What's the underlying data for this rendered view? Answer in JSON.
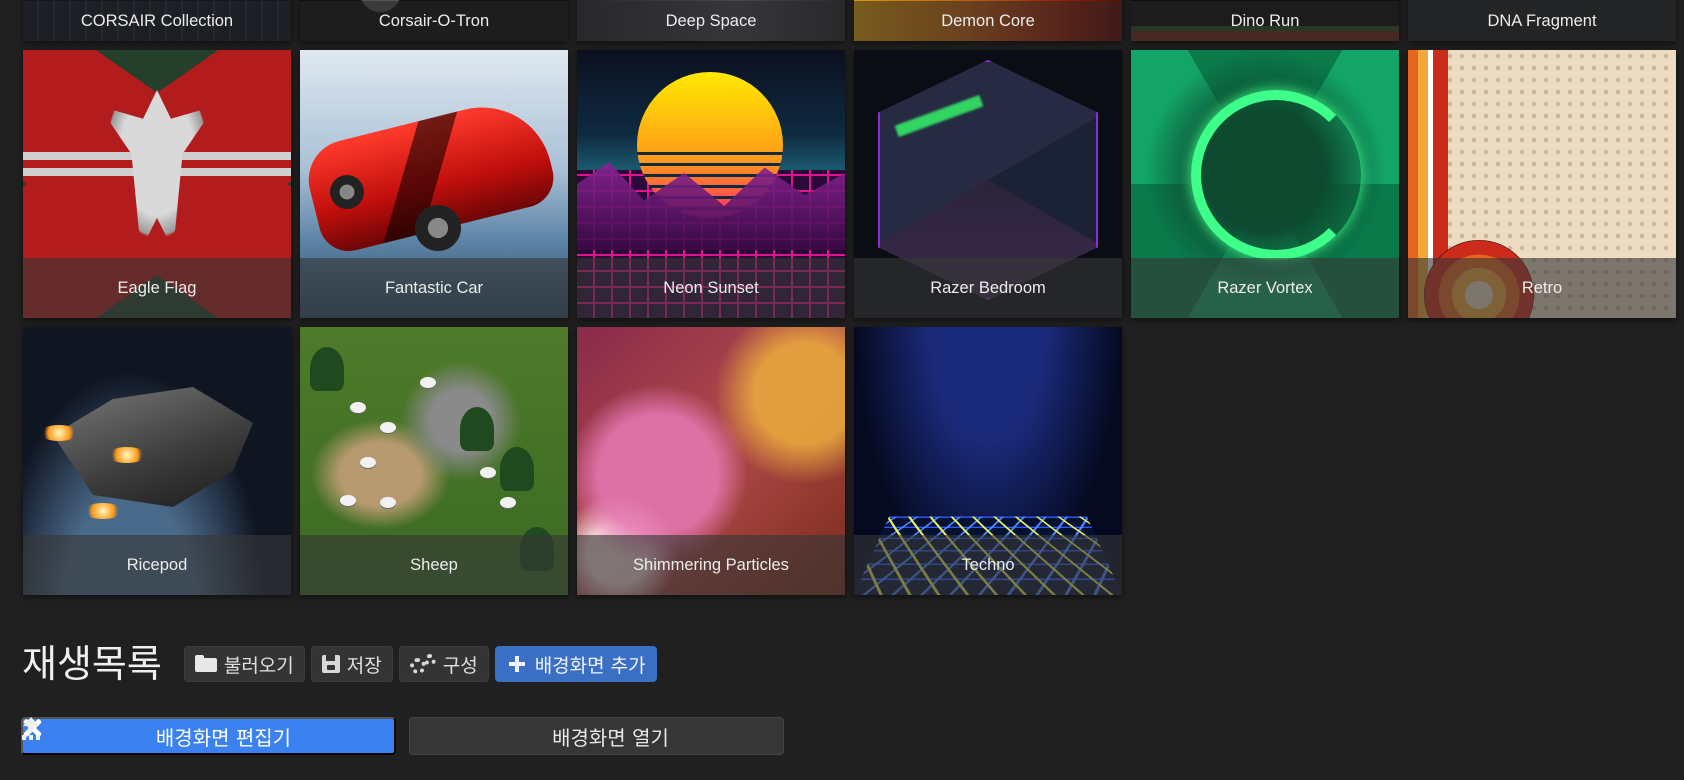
{
  "wallpapers": {
    "row_top": [
      {
        "label": "CORSAIR Collection"
      },
      {
        "label": "Corsair-O-Tron"
      },
      {
        "label": "Deep Space"
      },
      {
        "label": "Demon Core"
      },
      {
        "label": "Dino Run"
      },
      {
        "label": "DNA Fragment"
      }
    ],
    "row_middle": [
      {
        "label": "Eagle Flag"
      },
      {
        "label": "Fantastic Car"
      },
      {
        "label": "Neon Sunset"
      },
      {
        "label": "Razer Bedroom"
      },
      {
        "label": "Razer Vortex"
      },
      {
        "label": "Retro"
      }
    ],
    "row_bottom": [
      {
        "label": "Ricepod"
      },
      {
        "label": "Sheep"
      },
      {
        "label": "Shimmering Particles"
      },
      {
        "label": "Techno"
      }
    ]
  },
  "playlist": {
    "title": "재생목록",
    "load_label": "불러오기",
    "save_label": "저장",
    "config_label": "구성",
    "add_wallpaper_label": "배경화면 추가"
  },
  "actions": {
    "editor_label": "배경화면 편집기",
    "open_label": "배경화면 열기"
  },
  "colors": {
    "background": "#202020",
    "primary_button": "#3b6fc4",
    "editor_button": "#3b82f0",
    "secondary_button": "#363636"
  },
  "icons": {
    "load": "folder-open-icon",
    "save": "floppy-disk-icon",
    "config": "cogs-icon",
    "add": "plus-icon",
    "editor": "tools-icon",
    "open": "upload-icon"
  }
}
